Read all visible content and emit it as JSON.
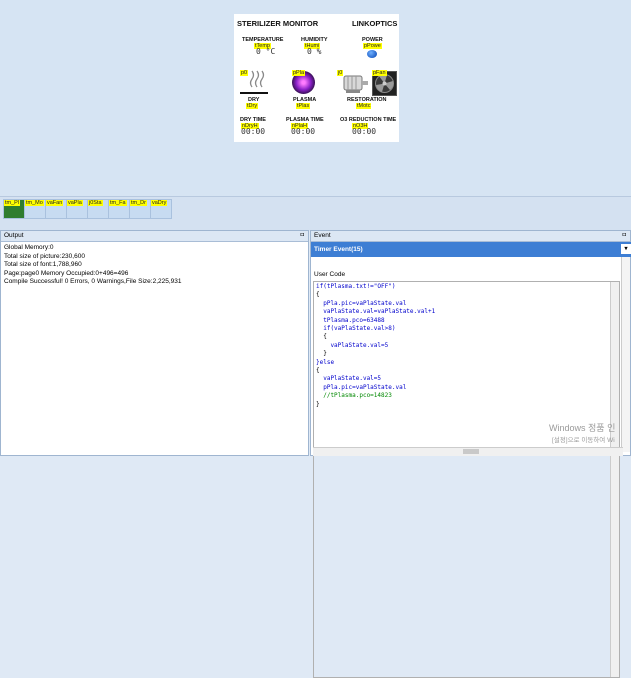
{
  "hmi": {
    "title": "STERILIZER MONITOR",
    "brand": "LINKOPTICS",
    "temperature_label": "TEMPERATURE",
    "temperature_tag": "tTemp",
    "temperature_value": "0 °C",
    "humidity_label": "HUMIDITY",
    "humidity_tag": "tHumi",
    "humidity_value": "0 %",
    "power_label": "POWER",
    "power_tag": "pPowe",
    "dry_tag": "p0",
    "dry_label": "DRY",
    "dry_value_tag": "tDry",
    "plasma_tag": "pPla",
    "plasma_label": "PLASMA",
    "plasma_value_tag": "tPlas",
    "restoration_tag": "j0",
    "fan_tag": "pFan",
    "restoration_label": "RESTORATION",
    "restoration_value_tag": "tMotc",
    "dry_time_label": "DRY TIME",
    "dry_time_tag": "nDryH",
    "dry_time_value": "00:00",
    "plasma_time_label": "PLASMA TIME",
    "plasma_time_tag": "nPlaH",
    "plasma_time_value": "00:00",
    "o3_label": "O3 REDUCTION TIME",
    "o3_tag": "nO3H",
    "o3_value": "00:00"
  },
  "components": [
    "tm_Pl",
    "tm_Mo",
    "vaFan",
    "vaPla",
    "j0Sta",
    "tm_Fa",
    "tm_Dr",
    "vaDry"
  ],
  "output": {
    "title": "Output",
    "pin": "ㅁ",
    "lines": [
      "Global Memory:0",
      "Total size of picture:230,600",
      "Total size of font:1,788,960",
      "Page:page0 Memory Occupied:0+496=496",
      "Compile Successful! 0 Errors, 0 Warnings,File Size:2,225,931"
    ]
  },
  "event": {
    "title": "Event",
    "pin": "ㅁ",
    "tab_label": "Timer Event(15)",
    "dropdown": "▾",
    "user_code_label": "User Code",
    "code_lines": [
      "if(tPlasma.txt!=\"OFF\")",
      "{",
      "  pPla.pic=vaPlaState.val",
      "  vaPlaState.val=vaPlaState.val+1",
      "  tPlasma.pco=63488",
      "  if(vaPlaState.val>8)",
      "  {",
      "    vaPlaState.val=5",
      "  }",
      "}else",
      "{",
      "  vaPlaState.val=5",
      "  pPla.pic=vaPlaState.val",
      "  //tPlasma.pco=14823",
      "}"
    ]
  },
  "watermark": {
    "line1": "Windows 정품 인",
    "line2": "[설정]으로 이동하여 Wi"
  }
}
